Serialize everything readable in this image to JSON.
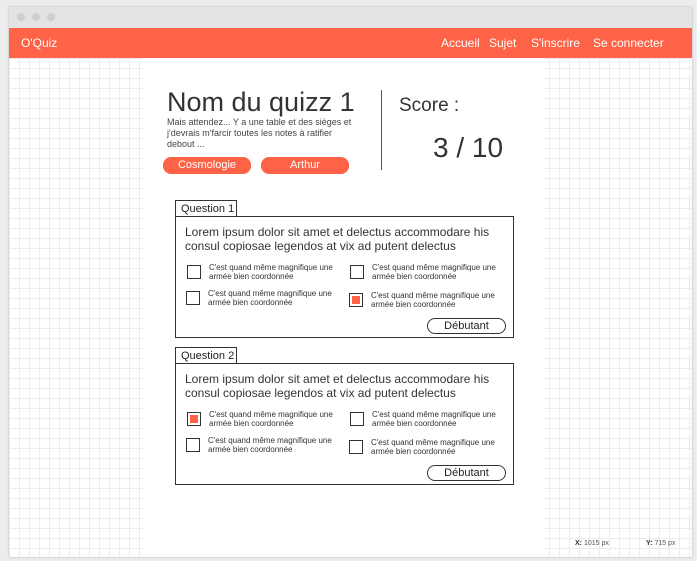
{
  "nav": {
    "brand": "O'Quiz",
    "links": [
      "Accueil",
      "Sujet",
      "S'inscrire",
      "Se connecter"
    ]
  },
  "quiz": {
    "title": "Nom du quizz 1",
    "description": "Mais attendez... Y a une table et des sièges et j'devrais m'farcir toutes les notes à ratifier debout ...",
    "tags": [
      "Cosmologie",
      "Arthur"
    ],
    "score_label": "Score :",
    "score_value": "3 / 10"
  },
  "questions": [
    {
      "label": "Question 1",
      "text": "Lorem ipsum dolor sit amet et delectus accommodare his consul copiosae legendos at vix ad putent delectus",
      "options": [
        {
          "text": "C'est quand même magnifique une armée bien coordonnée",
          "checked": false
        },
        {
          "text": "C'est quand même magnifique une armée bien coordonnée",
          "checked": false
        },
        {
          "text": "C'est quand même magnifique une armée bien coordonnée",
          "checked": false
        },
        {
          "text": "C'est quand même magnifique une armée bien coordonnée",
          "checked": true
        }
      ],
      "level": "Débutant"
    },
    {
      "label": "Question 2",
      "text": "Lorem ipsum dolor sit amet et delectus accommodare his consul copiosae legendos at vix ad putent delectus",
      "options": [
        {
          "text": "C'est quand même magnifique une armée bien coordonnée",
          "checked": true
        },
        {
          "text": "C'est quand même magnifique une armée bien coordonnée",
          "checked": false
        },
        {
          "text": "C'est quand même magnifique une armée bien coordonnée",
          "checked": false
        },
        {
          "text": "C'est quand même magnifique une armée bien coordonnée",
          "checked": false
        }
      ],
      "level": "Débutant"
    }
  ],
  "status": {
    "x_label": "X:",
    "x_value": "1015 px",
    "y_label": "Y:",
    "y_value": "715 px"
  },
  "colors": {
    "accent": "#ff6347",
    "window_chrome": "#e3e3e3"
  }
}
